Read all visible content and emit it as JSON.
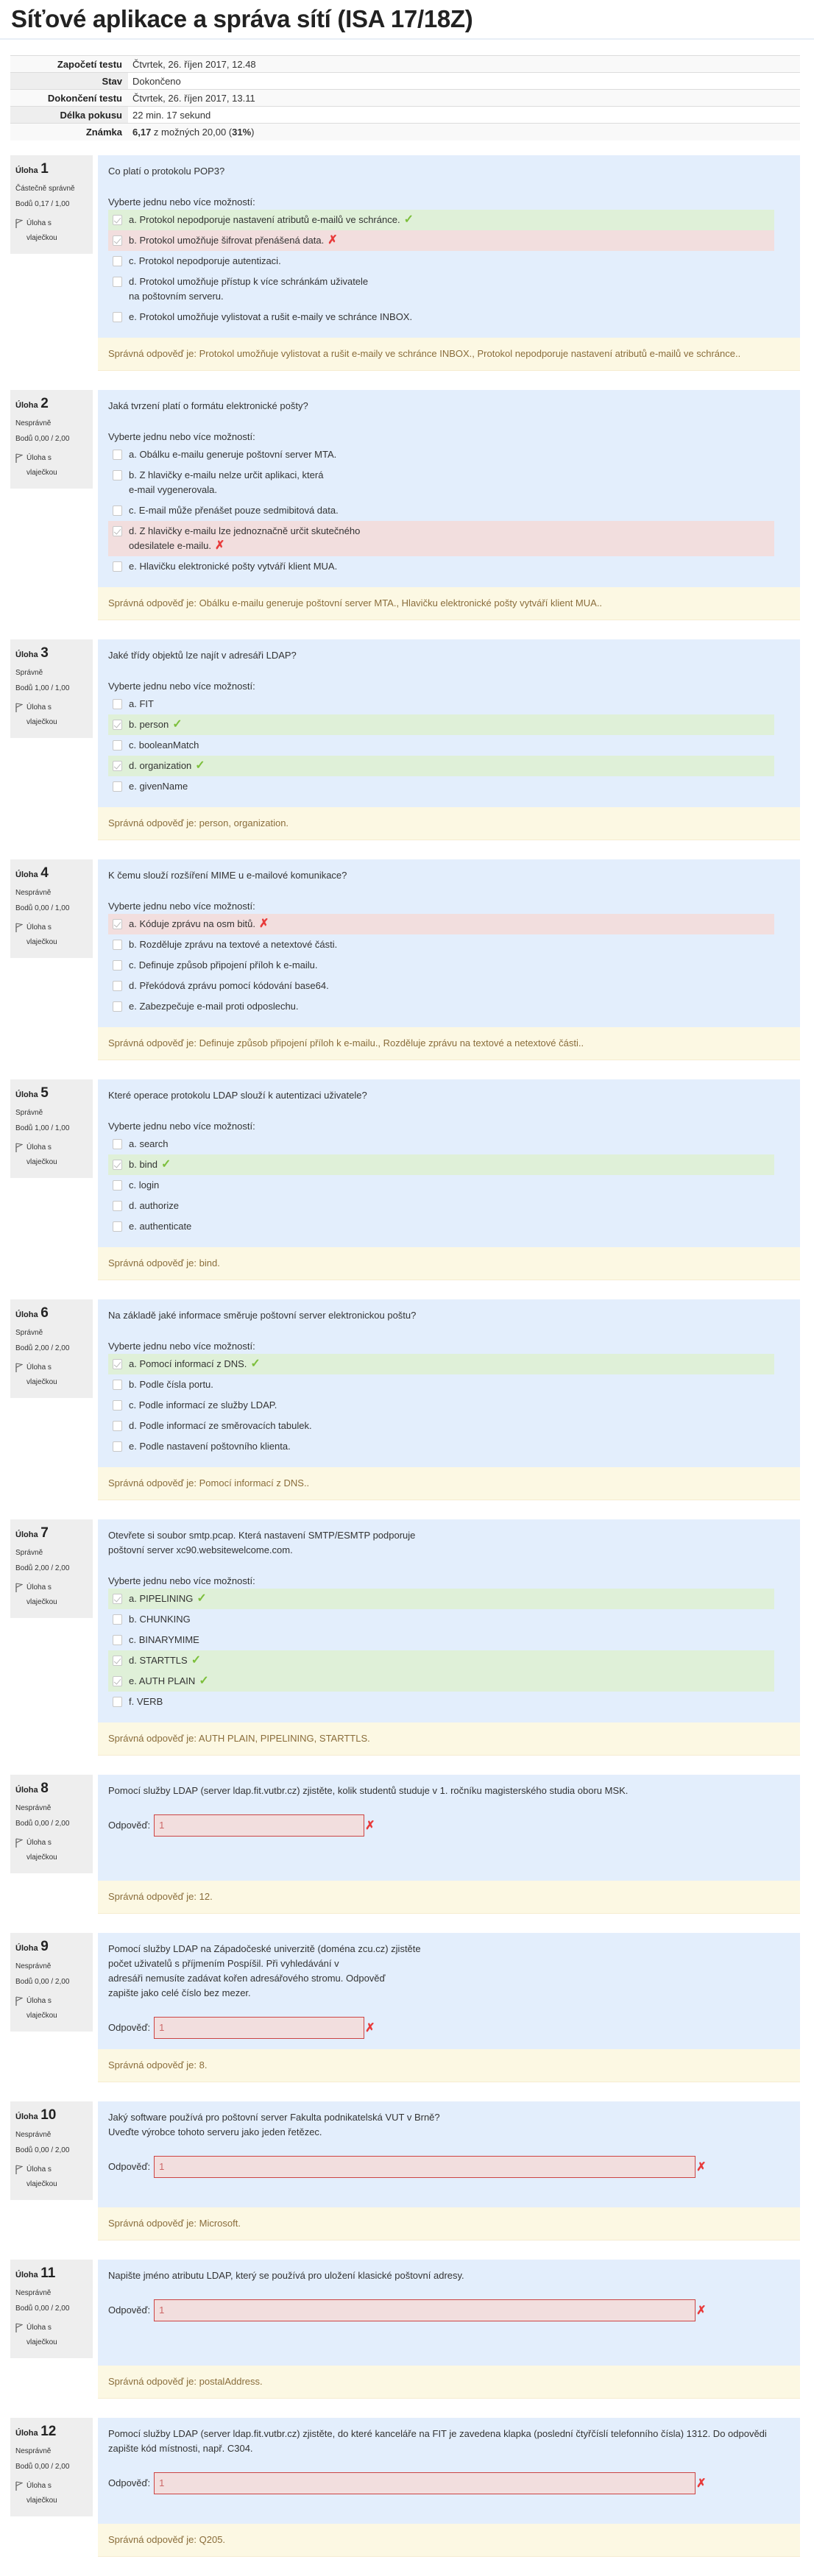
{
  "page_title": "Síťové aplikace a správa sítí (ISA 17/18Z)",
  "summary": [
    {
      "label": "Započetí testu",
      "value": "Čtvrtek, 26. říjen 2017, 12.48"
    },
    {
      "label": "Stav",
      "value": "Dokončeno"
    },
    {
      "label": "Dokončení testu",
      "value": "Čtvrtek, 26. říjen 2017, 13.11"
    },
    {
      "label": "Délka pokusu",
      "value": "22 min. 17 sekund"
    },
    {
      "label": "Známka",
      "value_bold": "6,17",
      "value_mid": " z možných 20,00 (",
      "value_pct": "31%",
      "value_end": ")"
    }
  ],
  "labels": {
    "question": "Úloha",
    "flag": "Úloha s\nvlaječkou",
    "prompt": "Vyberte jednu nebo více možností:",
    "answer": "Odpověď:"
  },
  "colors": {
    "correct_bg": "#dff0d8",
    "incorrect_bg": "#f2dede",
    "question_bg": "#e3eefc",
    "feedback_bg": "#fcf8e3",
    "check": "#7cbf3b",
    "cross": "#e83a3a"
  },
  "questions": [
    {
      "number": "1",
      "state": "Částečně správně",
      "grade": "Bodů 0,17 / 1,00",
      "text": "Co platí o protokolu POP3?",
      "options": [
        {
          "label": "a. Protokol nepodporuje nastavení atributů e-mailů ve schránce.",
          "checked": true,
          "result": "correct"
        },
        {
          "label": "b. Protokol umožňuje šifrovat přenášená data.",
          "checked": true,
          "result": "incorrect"
        },
        {
          "label": "c. Protokol nepodporuje autentizaci.",
          "checked": false,
          "result": ""
        },
        {
          "label": "d. Protokol umožňuje přístup k více schránkám uživatele\nna poštovním serveru.",
          "checked": false,
          "result": ""
        },
        {
          "label": "e. Protokol umožňuje vylistovat a rušit e-maily ve schránce INBOX.",
          "checked": false,
          "result": ""
        }
      ],
      "feedback": "Správná odpověď je: Protokol umožňuje vylistovat a rušit e-maily ve schránce INBOX., Protokol nepodporuje nastavení atributů e-mailů ve schránce.."
    },
    {
      "number": "2",
      "state": "Nesprávně",
      "grade": "Bodů 0,00 / 2,00",
      "text": "Jaká tvrzení platí o formátu elektronické pošty?",
      "options": [
        {
          "label": "a. Obálku e-mailu generuje poštovní server MTA.",
          "checked": false,
          "result": ""
        },
        {
          "label": "b. Z hlavičky e-mailu nelze určit aplikaci, která\ne-mail vygenerovala.",
          "checked": false,
          "result": ""
        },
        {
          "label": "c. E-mail může přenášet pouze sedmibitová data.",
          "checked": false,
          "result": ""
        },
        {
          "label": "d. Z hlavičky e-mailu lze jednoznačně určit skutečného\nodesilatele e-mailu.",
          "checked": true,
          "result": "incorrect"
        },
        {
          "label": "e. Hlavičku elektronické pošty vytváří klient MUA.",
          "checked": false,
          "result": ""
        }
      ],
      "feedback": "Správná odpověď je: Obálku e-mailu generuje poštovní server MTA., Hlavičku elektronické pošty vytváří klient MUA.."
    },
    {
      "number": "3",
      "state": "Správně",
      "grade": "Bodů 1,00 / 1,00",
      "text": "Jaké třídy objektů lze najít v adresáři LDAP?",
      "options": [
        {
          "label": "a. FIT",
          "checked": false,
          "result": ""
        },
        {
          "label": "b. person",
          "checked": true,
          "result": "correct"
        },
        {
          "label": "c. booleanMatch",
          "checked": false,
          "result": ""
        },
        {
          "label": "d. organization",
          "checked": true,
          "result": "correct"
        },
        {
          "label": "e. givenName",
          "checked": false,
          "result": ""
        }
      ],
      "feedback": "Správná odpověď je: person, organization."
    },
    {
      "number": "4",
      "state": "Nesprávně",
      "grade": "Bodů 0,00 / 1,00",
      "text": "K čemu slouží rozšíření MIME u e-mailové komunikace?",
      "options": [
        {
          "label": "a. Kóduje zprávu na osm bitů.",
          "checked": true,
          "result": "incorrect"
        },
        {
          "label": "b. Rozděluje zprávu na textové a netextové části.",
          "checked": false,
          "result": ""
        },
        {
          "label": "c. Definuje způsob připojení příloh k e-mailu.",
          "checked": false,
          "result": ""
        },
        {
          "label": "d. Překódová zprávu pomocí kódování base64.",
          "checked": false,
          "result": ""
        },
        {
          "label": "e. Zabezpečuje e-mail proti odposlechu.",
          "checked": false,
          "result": ""
        }
      ],
      "feedback": "Správná odpověď je: Definuje způsob připojení příloh k e-mailu., Rozděluje zprávu na textové a netextové části.."
    },
    {
      "number": "5",
      "state": "Správně",
      "grade": "Bodů 1,00 / 1,00",
      "text": "Které operace protokolu LDAP slouží k autentizaci uživatele?",
      "options": [
        {
          "label": "a. search",
          "checked": false,
          "result": ""
        },
        {
          "label": "b. bind",
          "checked": true,
          "result": "correct"
        },
        {
          "label": "c. login",
          "checked": false,
          "result": ""
        },
        {
          "label": "d. authorize",
          "checked": false,
          "result": ""
        },
        {
          "label": "e. authenticate",
          "checked": false,
          "result": ""
        }
      ],
      "feedback": "Správná odpověď je: bind."
    },
    {
      "number": "6",
      "state": "Správně",
      "grade": "Bodů 2,00 / 2,00",
      "text": "Na základě jaké informace směruje poštovní server elektronickou poštu?",
      "options": [
        {
          "label": "a. Pomocí informací z DNS.",
          "checked": true,
          "result": "correct"
        },
        {
          "label": "b. Podle čísla portu.",
          "checked": false,
          "result": ""
        },
        {
          "label": "c. Podle informací ze služby LDAP.",
          "checked": false,
          "result": ""
        },
        {
          "label": "d. Podle informací ze směrovacích tabulek.",
          "checked": false,
          "result": ""
        },
        {
          "label": "e. Podle nastavení poštovního klienta.",
          "checked": false,
          "result": ""
        }
      ],
      "feedback": "Správná odpověď je: Pomocí informací z DNS.."
    },
    {
      "number": "7",
      "state": "Správně",
      "grade": "Bodů 2,00 / 2,00",
      "text": "Otevřete si soubor smtp.pcap. Která nastavení SMTP/ESMTP podporuje\npoštovní server xc90.websitewelcome.com.",
      "options": [
        {
          "label": "a. PIPELINING",
          "checked": true,
          "result": "correct"
        },
        {
          "label": "b. CHUNKING",
          "checked": false,
          "result": ""
        },
        {
          "label": "c. BINARYMIME",
          "checked": false,
          "result": ""
        },
        {
          "label": "d. STARTTLS",
          "checked": true,
          "result": "correct"
        },
        {
          "label": "e. AUTH PLAIN",
          "checked": true,
          "result": "correct"
        },
        {
          "label": "f. VERB",
          "checked": false,
          "result": ""
        }
      ],
      "feedback": "Správná odpověď je: AUTH PLAIN, PIPELINING, STARTTLS."
    },
    {
      "number": "8",
      "state": "Nesprávně",
      "grade": "Bodů 0,00 / 2,00",
      "text": "Pomocí služby LDAP (server ldap.fit.vutbr.cz) zjistěte, kolik studentů studuje v 1. ročníku magisterského studia oboru MSK.",
      "answer": "1",
      "input_size": "narrow",
      "feedback": "Správná odpověď je: 12."
    },
    {
      "number": "9",
      "state": "Nesprávně",
      "grade": "Bodů 0,00 / 2,00",
      "text": "Pomocí služby LDAP na Západočeské univerzitě (doména zcu.cz) zjistěte\npočet uživatelů s příjmením Pospíšil. Při vyhledávání v\nadresáři nemusíte zadávat kořen adresářového stromu. Odpověď\nzapište jako celé číslo bez mezer.",
      "answer": "1",
      "input_size": "narrow",
      "feedback": "Správná odpověď je: 8."
    },
    {
      "number": "10",
      "state": "Nesprávně",
      "grade": "Bodů 0,00 / 2,00",
      "text": "Jaký software používá pro poštovní server Fakulta podnikatelská VUT v Brně?\nUveďte výrobce tohoto serveru jako jeden řetězec.",
      "answer": "1",
      "input_size": "wide",
      "feedback": "Správná odpověď je: Microsoft."
    },
    {
      "number": "11",
      "state": "Nesprávně",
      "grade": "Bodů 0,00 / 2,00",
      "text": "Napište jméno atributu LDAP, který se používá pro uložení klasické poštovní adresy.",
      "answer": "1",
      "input_size": "wide",
      "feedback": "Správná odpověď je: postalAddress."
    },
    {
      "number": "12",
      "state": "Nesprávně",
      "grade": "Bodů 0,00 / 2,00",
      "text": "Pomocí služby LDAP (server ldap.fit.vutbr.cz) zjistěte, do které kanceláře na FIT je zavedena klapka (poslední čtyřčíslí telefonního čísla) 1312. Do odpovědi zapište kód místnosti, např. C304.",
      "answer": "1",
      "input_size": "wide",
      "feedback": "Správná odpověď je: Q205."
    }
  ]
}
